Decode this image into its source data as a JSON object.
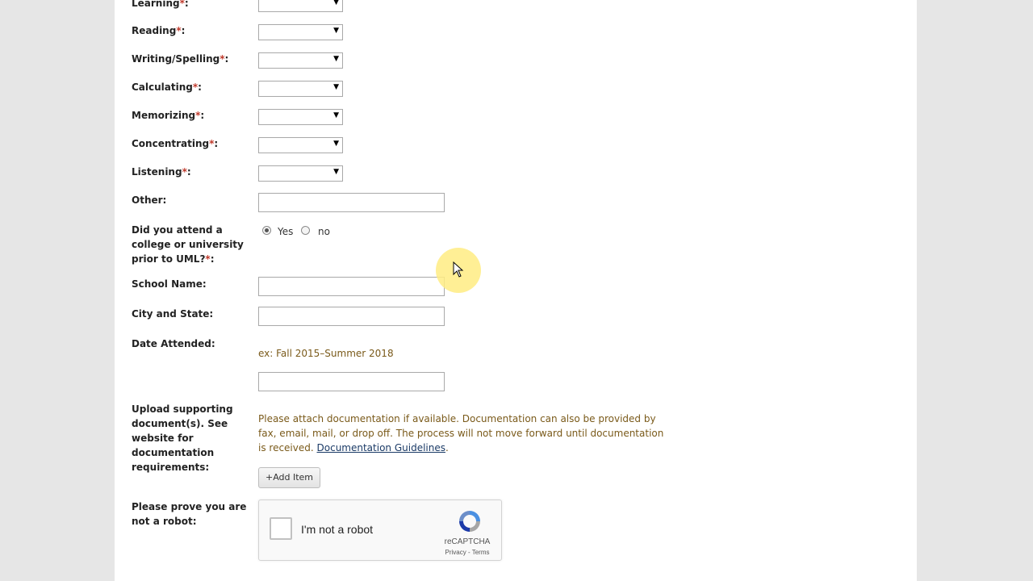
{
  "form": {
    "fields": [
      {
        "label": "Learning",
        "required": "*",
        "suffix": ":"
      },
      {
        "label": "Reading",
        "required": "*",
        "suffix": ":"
      },
      {
        "label": "Writing/Spelling",
        "required": "*",
        "suffix": ":"
      },
      {
        "label": "Calculating",
        "required": "*",
        "suffix": ":"
      },
      {
        "label": "Memorizing",
        "required": "*",
        "suffix": ":"
      },
      {
        "label": "Concentrating",
        "required": "*",
        "suffix": ":"
      },
      {
        "label": "Listening",
        "required": "*",
        "suffix": ":"
      }
    ],
    "other_label": "Other:",
    "prior_college_label": "Did you attend a college or university prior to UML?",
    "prior_college_required": "*",
    "prior_college_suffix": ":",
    "prior_college_options": [
      {
        "label": "Yes",
        "selected": true
      },
      {
        "label": "no",
        "selected": false
      }
    ],
    "school_name_label": "School Name:",
    "city_state_label": "City and State:",
    "date_attended_label": "Date Attended:",
    "date_attended_hint": "ex: Fall 2015–Summer 2018",
    "upload_label": "Upload supporting document(s). See website for documentation requirements:",
    "upload_help": "Please attach documentation if available. Documentation can also be provided by fax, email, mail, or drop off. The process will not move forward until documentation is received.",
    "upload_link": "Documentation Guidelines",
    "upload_period": ".",
    "add_item_icon": "+",
    "add_item_label": "Add Item",
    "robot_label": "Please prove you are not a robot:",
    "captcha": {
      "checkbox_label": "I'm not a robot",
      "brand": "reCAPTCHA",
      "links": "Privacy - Terms"
    }
  },
  "icons": {
    "dropdown": "dropdown-arrow-icon",
    "captcha_logo": "recaptcha-logo-icon"
  },
  "colors": {
    "required": "#c0392b",
    "hint": "#7a5a1a",
    "link": "#1a3a66",
    "background": "#e6e6e6"
  }
}
